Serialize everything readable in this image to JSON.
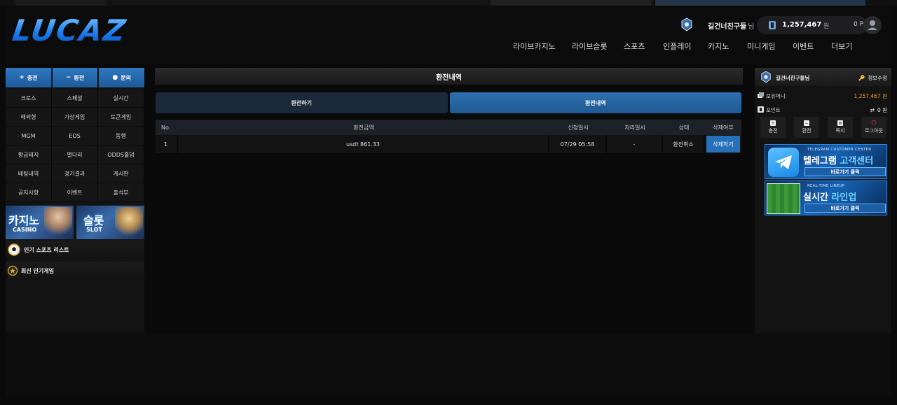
{
  "header": {
    "logo_text": "LUCAZ",
    "username": "길건너친구들",
    "username_suffix": "님",
    "balance": "1,257,467",
    "balance_unit": "원",
    "points": "0 P",
    "nav": [
      "라이브카지노",
      "라이브슬롯",
      "스포츠",
      "인플레이",
      "카지노",
      "미니게임",
      "이벤트",
      "더보기"
    ]
  },
  "left": {
    "quick": [
      {
        "icon": "+",
        "label": "충전"
      },
      {
        "icon": "−",
        "label": "환전"
      },
      {
        "icon": "●",
        "label": "문의"
      }
    ],
    "menu": [
      "크로스",
      "스페셜",
      "실시간",
      "해외형",
      "가상게임",
      "토큰게임",
      "MGM",
      "EOS",
      "동행",
      "황금돼지",
      "별다리",
      "ODDS홀덤",
      "배팅내역",
      "경기결과",
      "게시판",
      "공지사항",
      "이벤트",
      "출석부"
    ],
    "banners": [
      {
        "big": "카지노",
        "small": "CASINO"
      },
      {
        "big": "슬롯",
        "small": "SLOT"
      }
    ],
    "sections": [
      "인기 스포츠 리스트",
      "최신 인기게임"
    ]
  },
  "center": {
    "title": "환전내역",
    "tabs": [
      "환전하기",
      "환전내역"
    ],
    "columns": [
      "No.",
      "환전금액",
      "신청일시",
      "처리일시",
      "상태",
      "삭제여부"
    ],
    "rows": [
      {
        "no": "1",
        "amount": "usdt 861.33",
        "requested": "07/29 05:58",
        "processed": "-",
        "status": "환전취소",
        "action": "삭제하기"
      }
    ]
  },
  "right": {
    "name": "길건너친구들님",
    "edit": "정보수정",
    "money_label": "보유머니",
    "money_value": "1,257,467 원",
    "point_label": "포인트",
    "point_value": "0 원",
    "actions": [
      "충전",
      "환전",
      "쪽지",
      "로그아웃"
    ],
    "promos": [
      {
        "sub": "TELEGRAM CUSTOMER CENTER",
        "main1": "텔레그램 ",
        "main2": "고객센터",
        "cta": "바로가기 클릭"
      },
      {
        "sub": "REAL-TIME LINEUP",
        "main1": "실시간 ",
        "main2": "라인업",
        "cta": "바로가기 클릭"
      }
    ]
  },
  "colors": {
    "accent": "#2671ba",
    "money": "#f0a020",
    "logo": "#2a8bff"
  }
}
